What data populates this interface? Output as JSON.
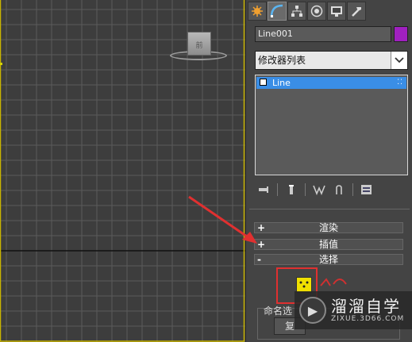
{
  "viewport": {
    "cube_label": "前",
    "grid_color": "#5a5a5a",
    "border_color": "#c8b400"
  },
  "panel": {
    "tabs": [
      {
        "icon": "create-icon"
      },
      {
        "icon": "modify-icon",
        "active": true
      },
      {
        "icon": "hierarchy-icon"
      },
      {
        "icon": "motion-icon"
      },
      {
        "icon": "display-icon"
      },
      {
        "icon": "utilities-icon"
      }
    ],
    "object_name": "Line001",
    "object_color": "#a020c0",
    "modifier_list": "修改器列表",
    "stack": [
      {
        "label": "Line"
      }
    ],
    "rollouts": [
      {
        "sign": "+",
        "title": "渲染"
      },
      {
        "sign": "+",
        "title": "插值"
      },
      {
        "sign": "-",
        "title": "选择"
      }
    ],
    "named_selection_label": "命名选",
    "copy_label": "复"
  },
  "watermark": {
    "title": "溜溜自学",
    "url": "ZIXUE.3D66.COM"
  },
  "annotation_color": "#e03030"
}
